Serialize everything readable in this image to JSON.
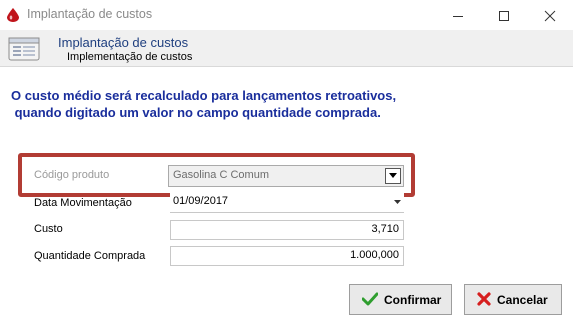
{
  "window": {
    "title": "Implantação de custos",
    "app_icon": "red-drop-icon"
  },
  "header": {
    "title": "Implantação de custos",
    "subtitle": "Implementação de custos",
    "icon": "form-window-icon"
  },
  "info": {
    "line1": "O custo médio será recalculado para lançamentos retroativos,",
    "line2": " quando digitado um valor no campo quantidade comprada."
  },
  "form": {
    "product": {
      "label": "Código produto",
      "value": "Gasolina C Comum",
      "disabled": true
    },
    "date": {
      "label": "Data Movimentação",
      "value": "01/09/2017"
    },
    "cost": {
      "label": "Custo",
      "value": "3,710"
    },
    "quantity": {
      "label": "Quantidade Comprada",
      "value": "1.000,000"
    }
  },
  "buttons": {
    "confirm": {
      "label": "Confirmar",
      "icon": "green-check-icon"
    },
    "cancel": {
      "label": "Cancelar",
      "icon": "red-x-icon"
    }
  },
  "colors": {
    "info_text": "#1a2e9c",
    "highlight_border": "#b23c34",
    "header_title": "#1f3f7f"
  }
}
